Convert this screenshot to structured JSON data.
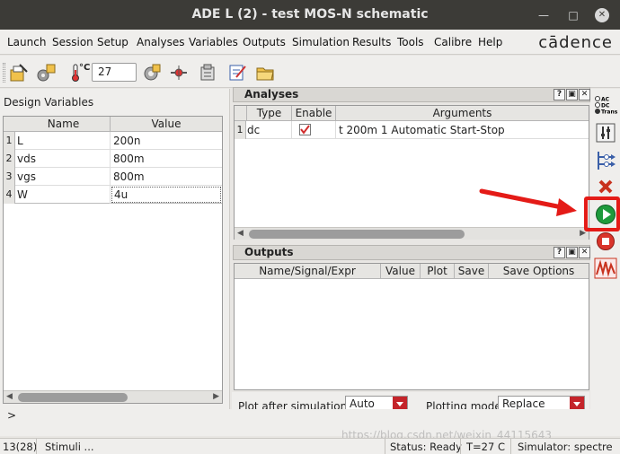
{
  "window": {
    "title": "ADE L (2) - test MOS-N schematic"
  },
  "menu": {
    "items": [
      "Launch",
      "Session",
      "Setup",
      "Analyses",
      "Variables",
      "Outputs",
      "Simulation",
      "Results",
      "Tools",
      "Calibre",
      "Help"
    ],
    "brand": "cādence"
  },
  "toolbar": {
    "temperature_unit": "°C",
    "temperature_value": "27"
  },
  "design_variables": {
    "header": "Design Variables",
    "columns": [
      "Name",
      "Value"
    ],
    "rows": [
      {
        "index": "1",
        "name": "L",
        "value": "200n"
      },
      {
        "index": "2",
        "name": "vds",
        "value": "800m"
      },
      {
        "index": "3",
        "name": "vgs",
        "value": "800m"
      },
      {
        "index": "4",
        "name": "W",
        "value": "4u"
      }
    ]
  },
  "analyses": {
    "title": "Analyses",
    "columns": [
      "Type",
      "Enable",
      "Arguments"
    ],
    "rows": [
      {
        "index": "1",
        "type": "dc",
        "enabled": true,
        "arguments": "t 200m 1 Automatic Start-Stop"
      }
    ]
  },
  "outputs": {
    "title": "Outputs",
    "columns": [
      "Name/Signal/Expr",
      "Value",
      "Plot",
      "Save",
      "Save Options"
    ]
  },
  "plot_controls": {
    "after_label": "Plot after simulation:",
    "after_value": "Auto",
    "mode_label": "Plotting mode:",
    "mode_value": "Replace"
  },
  "command_prompt": ">",
  "sidebar_labels": {
    "ac": "AC",
    "dc": "DC",
    "trans": "Trans"
  },
  "status": {
    "position": "13(28)",
    "stimuli": "Stimuli ...",
    "state": "Status: Ready",
    "temp": "T=27  C",
    "simulator": "Simulator: spectre"
  },
  "watermark": "https://blog.csdn.net/weixin_44115643",
  "colors": {
    "highlight": "#e41b17",
    "run": "#1e9a3c",
    "stop": "#d9342b"
  }
}
